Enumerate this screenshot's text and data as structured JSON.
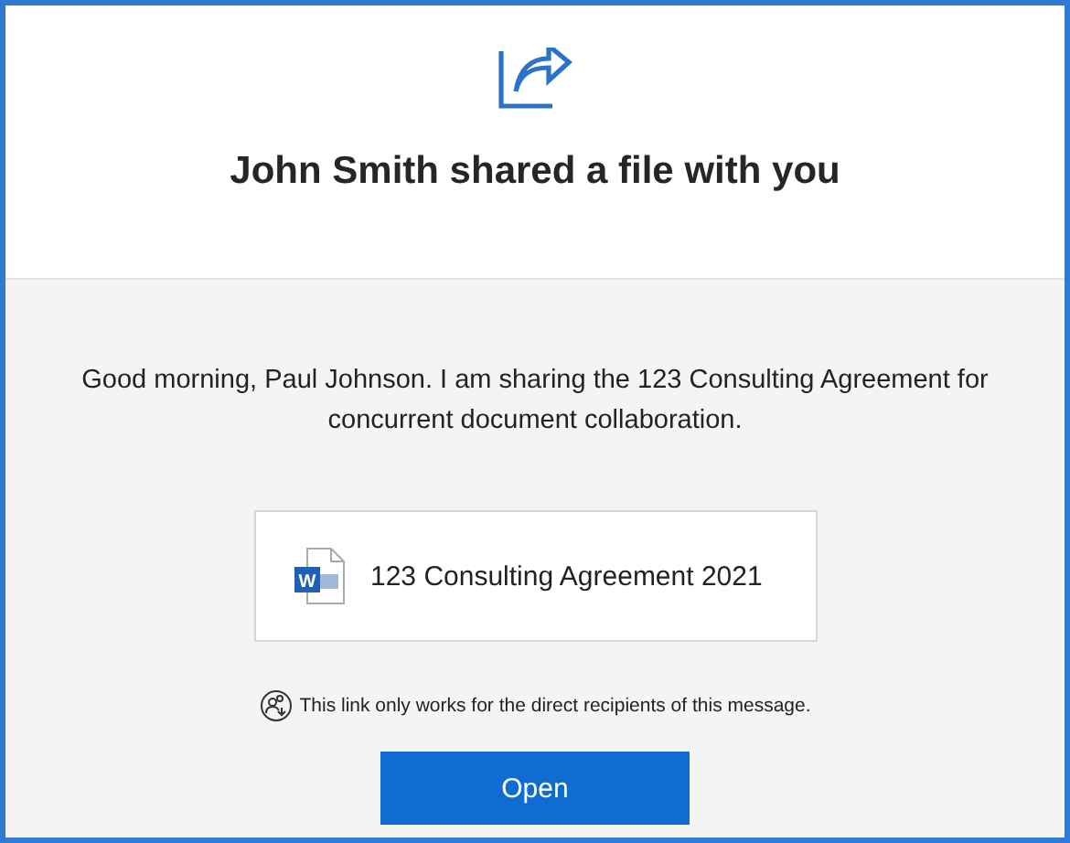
{
  "header": {
    "title": "John Smith shared a file with you"
  },
  "message": "Good morning, Paul Johnson. I am sharing the 123 Consulting Agreement for concurrent document collaboration.",
  "file": {
    "kind": "word",
    "icon_letter": "W",
    "name": "123 Consulting Agreement 2021"
  },
  "notice": "This link only works for the direct recipients of this message.",
  "button": {
    "label": "Open"
  }
}
